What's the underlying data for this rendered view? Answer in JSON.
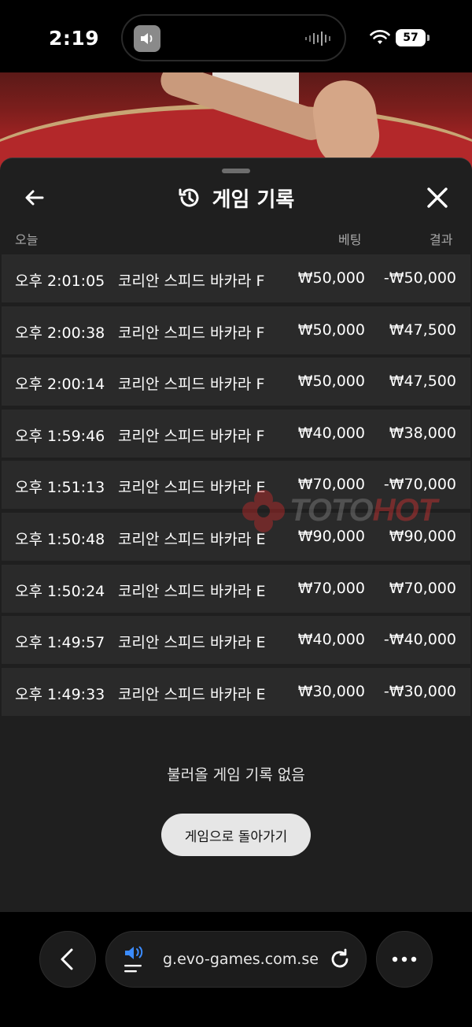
{
  "status": {
    "time": "2:19",
    "battery": "57"
  },
  "sheet": {
    "title": "게임 기록",
    "columns": {
      "today": "오늘",
      "bet": "베팅",
      "result": "결과"
    },
    "rows": [
      {
        "time": "오후 2:01:05",
        "game": "코리안 스피드 바카라 F",
        "bet": "₩50,000",
        "result": "-₩50,000"
      },
      {
        "time": "오후 2:00:38",
        "game": "코리안 스피드 바카라 F",
        "bet": "₩50,000",
        "result": "₩47,500"
      },
      {
        "time": "오후 2:00:14",
        "game": "코리안 스피드 바카라 F",
        "bet": "₩50,000",
        "result": "₩47,500"
      },
      {
        "time": "오후 1:59:46",
        "game": "코리안 스피드 바카라 F",
        "bet": "₩40,000",
        "result": "₩38,000"
      },
      {
        "time": "오후 1:51:13",
        "game": "코리안 스피드 바카라 E",
        "bet": "₩70,000",
        "result": "-₩70,000"
      },
      {
        "time": "오후 1:50:48",
        "game": "코리안 스피드 바카라 E",
        "bet": "₩90,000",
        "result": "₩90,000"
      },
      {
        "time": "오후 1:50:24",
        "game": "코리안 스피드 바카라 E",
        "bet": "₩70,000",
        "result": "₩70,000"
      },
      {
        "time": "오후 1:49:57",
        "game": "코리안 스피드 바카라 E",
        "bet": "₩40,000",
        "result": "-₩40,000"
      },
      {
        "time": "오후 1:49:33",
        "game": "코리안 스피드 바카라 E",
        "bet": "₩30,000",
        "result": "-₩30,000"
      }
    ],
    "empty_message": "불러올 게임 기록 없음",
    "return_button": "게임으로 돌아가기"
  },
  "watermark": {
    "text_a": "TOTO",
    "text_b": "HOT"
  },
  "browser": {
    "url": "g.evo-games.com.se"
  },
  "colors": {
    "sheet_bg": "#1f1f1f",
    "row_bg": "#2a2a2a",
    "accent_blue": "#3b8cff",
    "watermark_red": "#d33333"
  }
}
